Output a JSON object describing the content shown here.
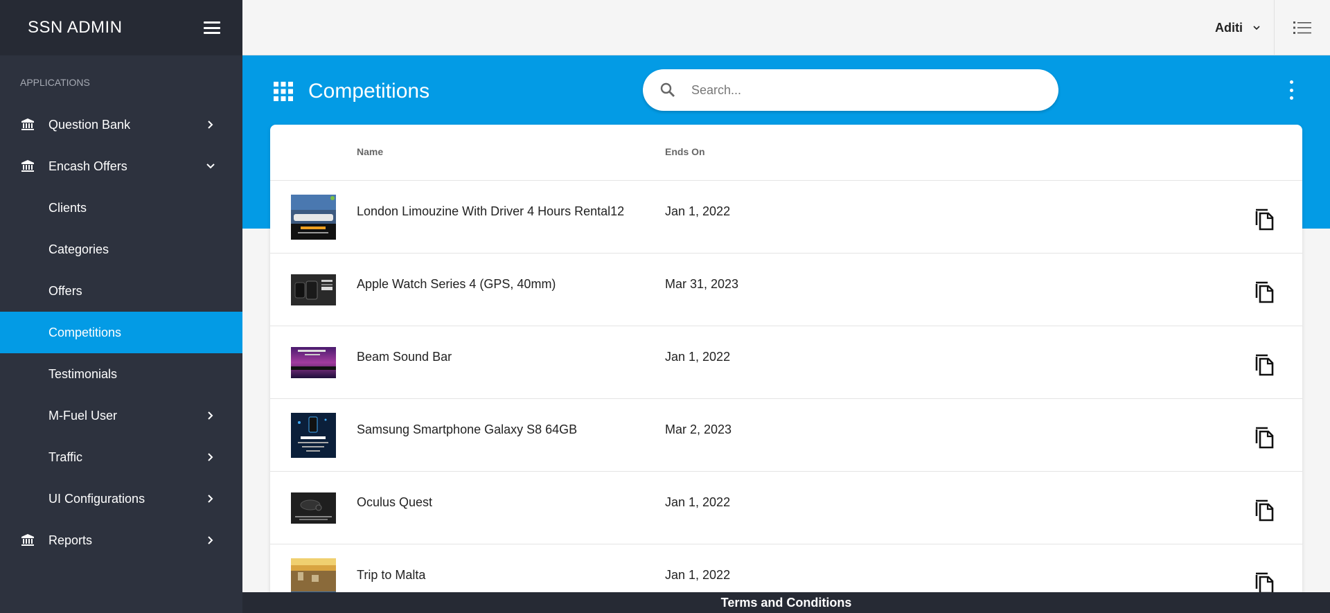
{
  "sidebar": {
    "title": "SSN ADMIN",
    "section_label": "APPLICATIONS",
    "items": [
      {
        "label": "Question Bank"
      },
      {
        "label": "Encash Offers"
      },
      {
        "label": "Clients"
      },
      {
        "label": "Categories"
      },
      {
        "label": "Offers"
      },
      {
        "label": "Competitions"
      },
      {
        "label": "Testimonials"
      },
      {
        "label": "M-Fuel User"
      },
      {
        "label": "Traffic"
      },
      {
        "label": "UI Configurations"
      },
      {
        "label": "Reports"
      }
    ]
  },
  "topbar": {
    "user_name": "Aditi"
  },
  "header": {
    "title": "Competitions",
    "search_placeholder": "Search..."
  },
  "table": {
    "columns": {
      "name": "Name",
      "ends_on": "Ends On"
    },
    "rows": [
      {
        "name": "London Limouzine With Driver 4 Hours Rental12",
        "ends_on": "Jan 1, 2022"
      },
      {
        "name": "Apple Watch Series 4 (GPS, 40mm)",
        "ends_on": "Mar 31, 2023"
      },
      {
        "name": "Beam Sound Bar",
        "ends_on": "Jan 1, 2022"
      },
      {
        "name": "Samsung Smartphone Galaxy S8 64GB",
        "ends_on": "Mar 2, 2023"
      },
      {
        "name": "Oculus Quest",
        "ends_on": "Jan 1, 2022"
      },
      {
        "name": "Trip to Malta",
        "ends_on": "Jan 1, 2022"
      }
    ]
  },
  "footer": {
    "label": "Terms and Conditions"
  },
  "colors": {
    "accent": "#039be5",
    "sidebar_bg": "#2d323e",
    "sidebar_head_bg": "#262a34"
  }
}
